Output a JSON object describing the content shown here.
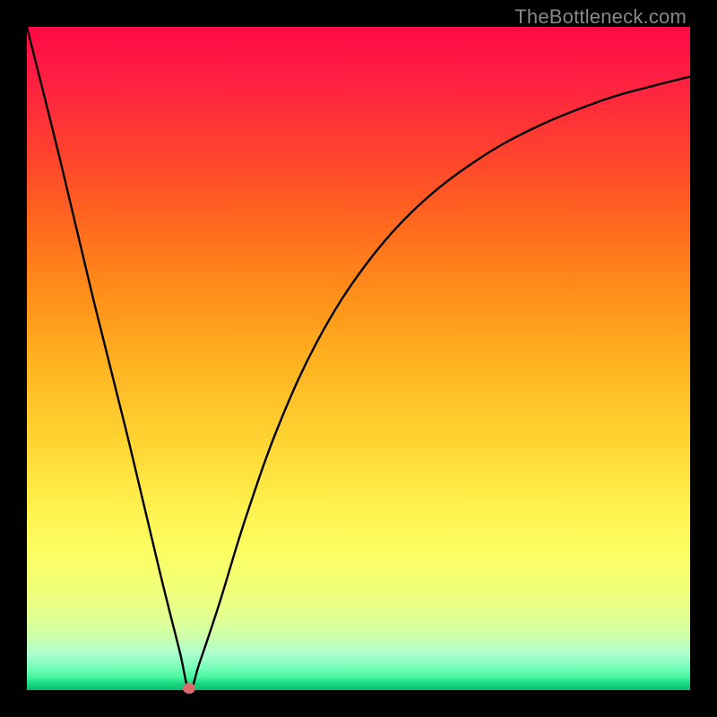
{
  "watermark": "TheBottleneck.com",
  "colors": {
    "frame": "#000000",
    "curve": "#000000",
    "marker": "#d96b6b",
    "gradient_top": "#ff0a46",
    "gradient_bottom": "#0cbb6f"
  },
  "chart_data": {
    "type": "line",
    "title": "",
    "xlabel": "",
    "ylabel": "",
    "xlim": [
      0,
      1
    ],
    "ylim": [
      0,
      1
    ],
    "annotations": [
      "TheBottleneck.com"
    ],
    "minimum_marker": {
      "x": 0.245,
      "y": 0.003
    },
    "series": [
      {
        "name": "bottleneck-curve",
        "x": [
          0.0,
          0.05,
          0.1,
          0.15,
          0.2,
          0.23,
          0.245,
          0.26,
          0.29,
          0.33,
          0.38,
          0.44,
          0.51,
          0.59,
          0.68,
          0.77,
          0.87,
          0.94,
          1.0
        ],
        "y": [
          1.0,
          0.8,
          0.59,
          0.39,
          0.18,
          0.06,
          0.0,
          0.04,
          0.13,
          0.26,
          0.4,
          0.53,
          0.64,
          0.73,
          0.8,
          0.85,
          0.89,
          0.91,
          0.925
        ]
      }
    ]
  }
}
